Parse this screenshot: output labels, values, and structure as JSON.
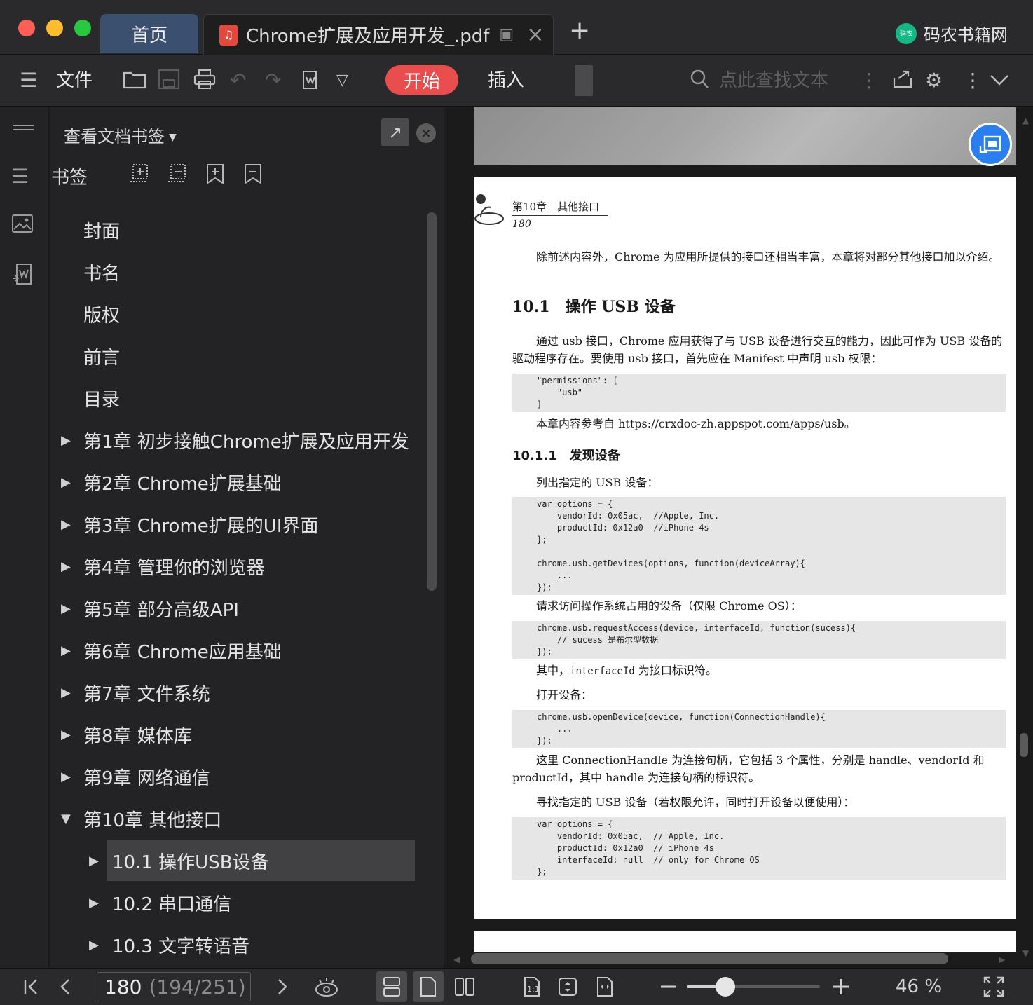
{
  "titlebar": {
    "home_tab": "首页",
    "doc_tab_title": "Chrome扩展及应用开发_.pdf",
    "brand": "码农书籍网",
    "brand_logo_text": "码农"
  },
  "toolbar": {
    "file_label": "文件",
    "start_label": "开始",
    "insert_label": "插入",
    "search_placeholder": "点此查找文本"
  },
  "panel": {
    "title": "查看文档书签",
    "bookmarks_label": "书签",
    "items": [
      {
        "label": "封面",
        "level": 0,
        "arrow": ""
      },
      {
        "label": "书名",
        "level": 0,
        "arrow": ""
      },
      {
        "label": "版权",
        "level": 0,
        "arrow": ""
      },
      {
        "label": "前言",
        "level": 0,
        "arrow": ""
      },
      {
        "label": "目录",
        "level": 0,
        "arrow": ""
      },
      {
        "label": "第1章 初步接触Chrome扩展及应用开发",
        "level": 0,
        "arrow": "▶"
      },
      {
        "label": "第2章 Chrome扩展基础",
        "level": 0,
        "arrow": "▶"
      },
      {
        "label": "第3章 Chrome扩展的UI界面",
        "level": 0,
        "arrow": "▶"
      },
      {
        "label": "第4章 管理你的浏览器",
        "level": 0,
        "arrow": "▶"
      },
      {
        "label": "第5章 部分高级API",
        "level": 0,
        "arrow": "▶"
      },
      {
        "label": "第6章 Chrome应用基础",
        "level": 0,
        "arrow": "▶"
      },
      {
        "label": "第7章 文件系统",
        "level": 0,
        "arrow": "▶"
      },
      {
        "label": "第8章 媒体库",
        "level": 0,
        "arrow": "▶"
      },
      {
        "label": "第9章 网络通信",
        "level": 0,
        "arrow": "▶"
      },
      {
        "label": "第10章 其他接口",
        "level": 0,
        "arrow": "▼"
      },
      {
        "label": "10.1 操作USB设备",
        "level": 1,
        "arrow": "▶",
        "selected": true
      },
      {
        "label": "10.2 串口通信",
        "level": 1,
        "arrow": "▶"
      },
      {
        "label": "10.3 文字转语音",
        "level": 1,
        "arrow": "▶"
      }
    ]
  },
  "page": {
    "running_head": "第10章　其他接口",
    "number": "180",
    "intro": "除前述内容外，Chrome 为应用所提供的接口还相当丰富，本章将对部分其他接口加以介绍。",
    "h1": "10.1　操作 USB 设备",
    "p1": "通过 usb 接口，Chrome 应用获得了与 USB 设备进行交互的能力，因此可作为 USB 设备的驱动程序存在。要使用 usb 接口，首先应在 Manifest 中声明 usb 权限：",
    "code1": "\"permissions\": [\n    \"usb\"\n]",
    "p2": "本章内容参考自 https://crxdoc-zh.appspot.com/apps/usb。",
    "h2": "10.1.1　发现设备",
    "p3": "列出指定的 USB 设备：",
    "code2": "var options = {\n    vendorId: 0x05ac,  //Apple, Inc.\n    productId: 0x12a0  //iPhone 4s\n};\n\nchrome.usb.getDevices(options, function(deviceArray){\n    ...\n});",
    "p4": "请求访问操作系统占用的设备（仅限 Chrome OS）：",
    "code3": "chrome.usb.requestAccess(device, interfaceId, function(sucess){\n    // sucess 是布尔型数据\n});",
    "p5_pre": "其中，",
    "p5_code": "interfaceId",
    "p5_post": " 为接口标识符。",
    "p6": "打开设备：",
    "code4": "chrome.usb.openDevice(device, function(ConnectionHandle){\n    ...\n});",
    "p7": "这里 ConnectionHandle 为连接句柄，它包括 3 个属性，分别是 handle、vendorId 和 productId，其中 handle 为连接句柄的标识符。",
    "p8": "寻找指定的 USB 设备（若权限允许，同时打开设备以便使用）：",
    "code5": "var options = {\n    vendorId: 0x05ac,  // Apple, Inc.\n    productId: 0x12a0  // iPhone 4s\n    interfaceId: null  // only for Chrome OS\n};"
  },
  "statusbar": {
    "current_page": "180",
    "page_total": "(194/251)",
    "zoom_label": "46 %",
    "zoom_fraction": 0.29
  },
  "colors": {
    "accent_red": "#ea4d4d",
    "accent_blue": "#2a7ef0",
    "home_tab": "#3b4f6e"
  }
}
